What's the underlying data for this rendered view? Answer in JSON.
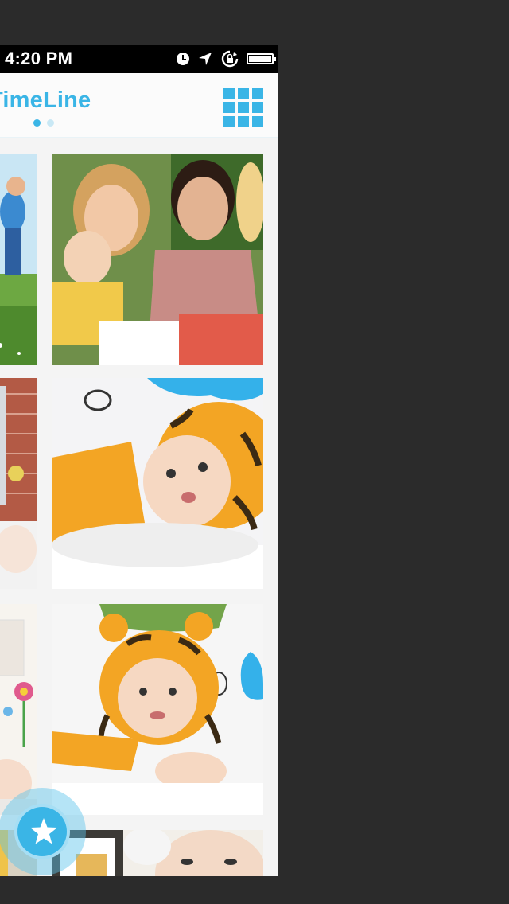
{
  "status_bar": {
    "time": "4:20 PM",
    "icons": [
      "alarm-clock-icon",
      "location-arrow-icon",
      "rotation-lock-icon",
      "battery-icon"
    ],
    "battery_level": 1.0
  },
  "header": {
    "title": "TimeLine",
    "page_count": 2,
    "active_page": 1,
    "grid_icon": "grid-icon"
  },
  "photos": [
    {
      "id": "boy-running-field",
      "description_icon": "photo-icon"
    },
    {
      "id": "family-smiling",
      "description_icon": "photo-icon"
    },
    {
      "id": "baby-brick-wall",
      "description_icon": "photo-icon"
    },
    {
      "id": "baby-tiger-hat-lying",
      "description_icon": "photo-icon"
    },
    {
      "id": "baby-flowers",
      "description_icon": "photo-icon"
    },
    {
      "id": "baby-tiger-hat-crawling",
      "description_icon": "photo-icon"
    },
    {
      "id": "bottom-left-photo",
      "description_icon": "photo-icon"
    },
    {
      "id": "bottom-right-baby",
      "description_icon": "photo-icon"
    }
  ],
  "fab": {
    "icon": "star-icon"
  },
  "colors": {
    "accent": "#3ab5e6",
    "background": "#2b2b2b",
    "status_bar": "#000000"
  }
}
